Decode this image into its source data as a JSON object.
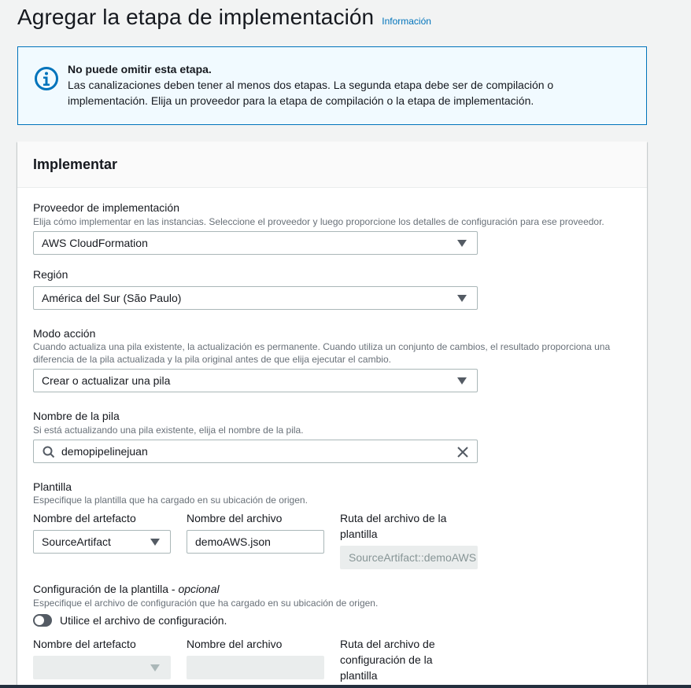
{
  "header": {
    "title": "Agregar la etapa de implementación",
    "info_link": "Información"
  },
  "alert": {
    "title": "No puede omitir esta etapa.",
    "line1": "Las canalizaciones deben tener al menos dos etapas. La segunda etapa debe ser de compilación o",
    "line2": "implementación. Elija un proveedor para la etapa de compilación o la etapa de implementación."
  },
  "panel": {
    "title": "Implementar",
    "provider": {
      "label": "Proveedor de implementación",
      "description": "Elija cómo implementar en las instancias. Seleccione el proveedor y luego proporcione los detalles de configuración para ese proveedor.",
      "value": "AWS CloudFormation"
    },
    "region": {
      "label": "Región",
      "value": "América del Sur (São Paulo)"
    },
    "action_mode": {
      "label": "Modo acción",
      "description_line1": "Cuando actualiza una pila existente, la actualización es permanente. Cuando utiliza un conjunto de cambios, el resultado proporciona una",
      "description_line2": "diferencia de la pila actualizada y la pila original antes de que elija ejecutar el cambio.",
      "value": "Crear o actualizar una pila"
    },
    "stack_name": {
      "label": "Nombre de la pila",
      "description": "Si está actualizando una pila existente, elija el nombre de la pila.",
      "value": "demopipelinejuan"
    },
    "template": {
      "label": "Plantilla",
      "description": "Especifique la plantilla que ha cargado en su ubicación de origen.",
      "artifact_label": "Nombre del artefacto",
      "artifact_value": "SourceArtifact",
      "filename_label": "Nombre del archivo",
      "filename_value": "demoAWS.json",
      "path_label_line1": "Ruta del archivo de la",
      "path_label_line2": "plantilla",
      "path_value": "SourceArtifact::demoAWS.json"
    },
    "template_config": {
      "label": "Configuración de la plantilla - ",
      "optional": "opcional",
      "description": "Especifique el archivo de configuración que ha cargado en su ubicación de origen.",
      "toggle_label": "Utilice el archivo de configuración.",
      "artifact_label": "Nombre del artefacto",
      "filename_label": "Nombre del archivo",
      "path_label_line1": "Ruta del archivo de",
      "path_label_line2": "configuración de la",
      "path_label_line3": "plantilla"
    }
  },
  "colors": {
    "link": "#0073bb",
    "alert_border": "#0073bb",
    "alert_bg": "#f1faff",
    "toggle_off": "#545b64"
  }
}
